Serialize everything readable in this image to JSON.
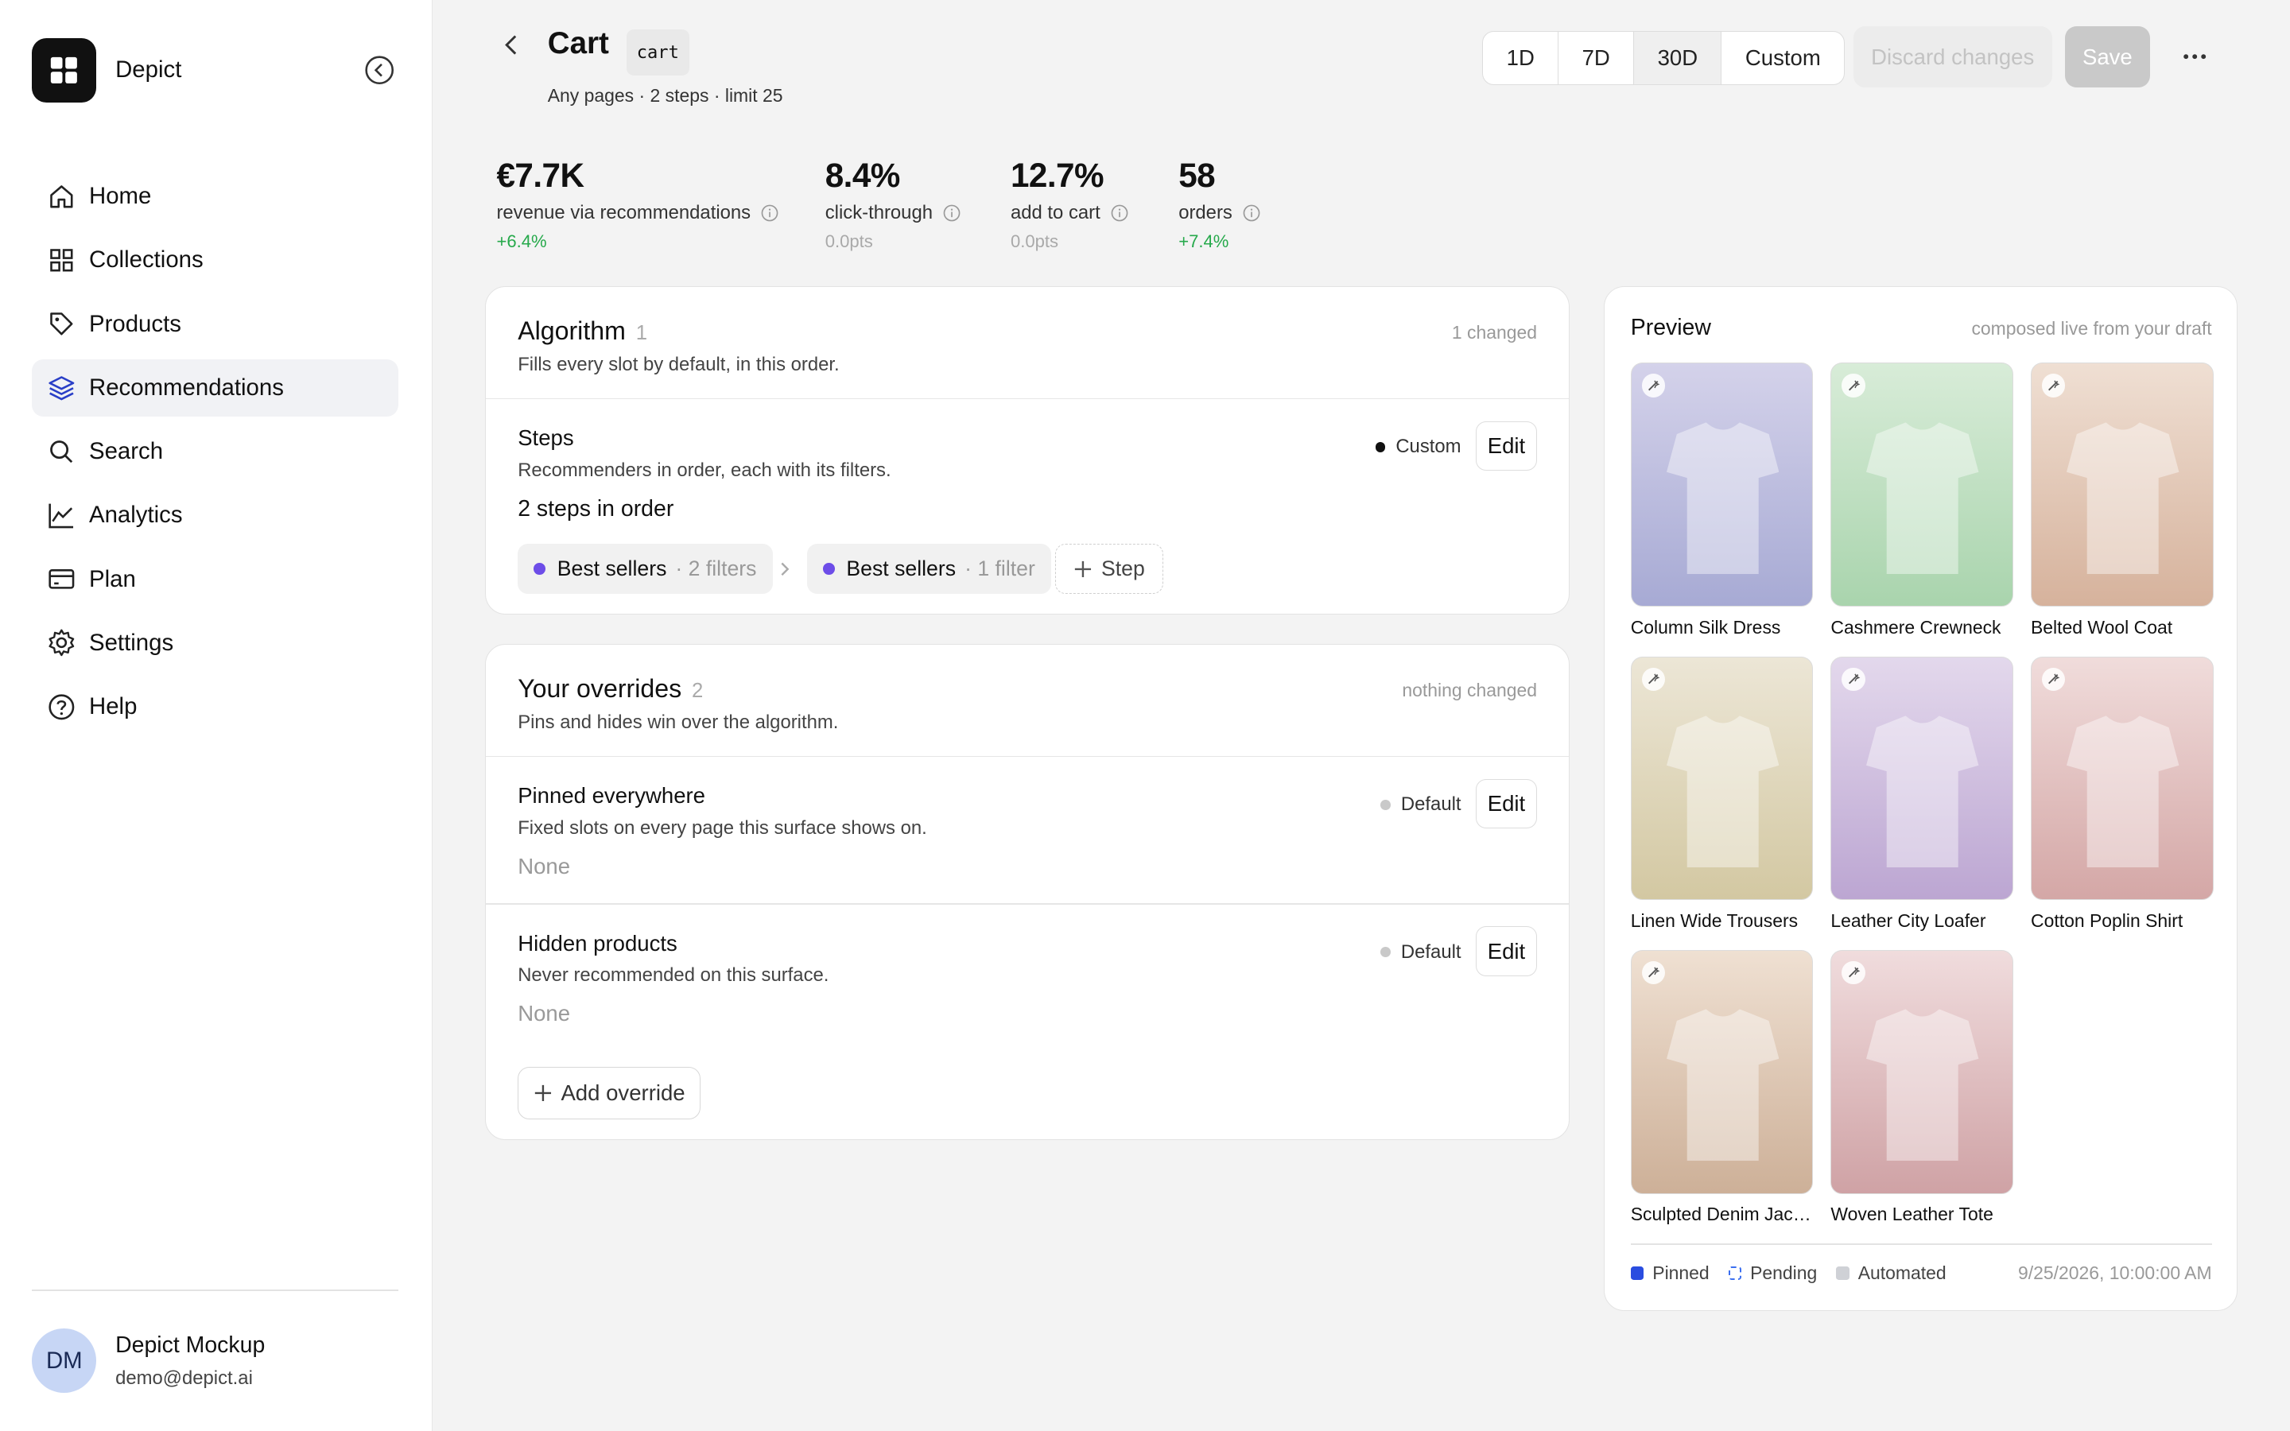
{
  "app": {
    "name": "Depict"
  },
  "sidebar": {
    "items": [
      {
        "label": "Home",
        "icon": "home-icon"
      },
      {
        "label": "Collections",
        "icon": "grid-icon"
      },
      {
        "label": "Products",
        "icon": "tag-icon"
      },
      {
        "label": "Recommendations",
        "icon": "layers-icon",
        "active": true
      },
      {
        "label": "Search",
        "icon": "search-icon"
      },
      {
        "label": "Analytics",
        "icon": "chart-line-icon"
      },
      {
        "label": "Plan",
        "icon": "credit-card-icon"
      },
      {
        "label": "Settings",
        "icon": "gear-icon"
      },
      {
        "label": "Help",
        "icon": "help-circle-icon"
      }
    ],
    "user": {
      "initials": "DM",
      "name": "Depict Mockup",
      "email": "demo@depict.ai"
    }
  },
  "header": {
    "title": "Cart",
    "code": "cart",
    "subtitle": "Any pages · 2 steps · limit 25",
    "ranges": [
      "1D",
      "7D",
      "30D",
      "Custom"
    ],
    "active_range": "30D",
    "discard_label": "Discard changes",
    "save_label": "Save"
  },
  "kpis": [
    {
      "value": "€7.7K",
      "label": "revenue via recommendations",
      "delta": "+6.4%",
      "positive": true
    },
    {
      "value": "8.4%",
      "label": "click-through",
      "delta": "0.0pts",
      "positive": false
    },
    {
      "value": "12.7%",
      "label": "add to cart",
      "delta": "0.0pts",
      "positive": false
    },
    {
      "value": "58",
      "label": "orders",
      "delta": "+7.4%",
      "positive": true
    }
  ],
  "algorithm": {
    "title": "Algorithm",
    "count": "1",
    "status": "1 changed",
    "desc": "Fills every slot by default, in this order.",
    "steps": {
      "title": "Steps",
      "desc": "Recommenders in order, each with its filters.",
      "badge": "Custom",
      "edit_label": "Edit",
      "summary": "2 steps in order",
      "items": [
        {
          "name": "Best sellers",
          "meta": "· 2 filters"
        },
        {
          "name": "Best sellers",
          "meta": "· 1 filter"
        }
      ],
      "add_label": "Step"
    }
  },
  "overrides": {
    "title": "Your overrides",
    "count": "2",
    "status": "nothing changed",
    "desc": "Pins and hides win over the algorithm.",
    "pinned": {
      "title": "Pinned everywhere",
      "desc": "Fixed slots on every page this surface shows on.",
      "badge": "Default",
      "edit_label": "Edit",
      "value": "None"
    },
    "hidden": {
      "title": "Hidden products",
      "desc": "Never recommended on this surface.",
      "badge": "Default",
      "edit_label": "Edit",
      "value": "None"
    },
    "add_label": "Add override"
  },
  "preview": {
    "title": "Preview",
    "note": "composed live from your draft",
    "products": [
      {
        "name": "Column Silk Dress",
        "color_top": "#d4d2ea",
        "color_bottom": "#a7aad4"
      },
      {
        "name": "Cashmere Crewneck",
        "color_top": "#d8ecd8",
        "color_bottom": "#a9d4ad"
      },
      {
        "name": "Belted Wool Coat",
        "color_top": "#efdfd3",
        "color_bottom": "#d6b29c"
      },
      {
        "name": "Linen Wide Trousers",
        "color_top": "#ece6d6",
        "color_bottom": "#d3c8a2"
      },
      {
        "name": "Leather City Loafer",
        "color_top": "#e3d8ec",
        "color_bottom": "#bca6d2"
      },
      {
        "name": "Cotton Poplin Shirt",
        "color_top": "#f0dcdb",
        "color_bottom": "#d4a7a6"
      },
      {
        "name": "Sculpted Denim Jac…",
        "color_top": "#efe0d2",
        "color_bottom": "#cdb098"
      },
      {
        "name": "Woven Leather Tote",
        "color_top": "#f0dcdd",
        "color_bottom": "#cfa2a5"
      }
    ],
    "legend": [
      {
        "label": "Pinned",
        "color": "#2a4de0"
      },
      {
        "label": "Pending",
        "color": "#3b6ff0"
      },
      {
        "label": "Automated",
        "color": "#cfd1d6"
      }
    ],
    "timestamp": "9/25/2026, 10:00:00 AM"
  },
  "colors": {
    "accent": "#6d4de8",
    "positive": "#26a94b",
    "pinned": "#2a4de0"
  }
}
